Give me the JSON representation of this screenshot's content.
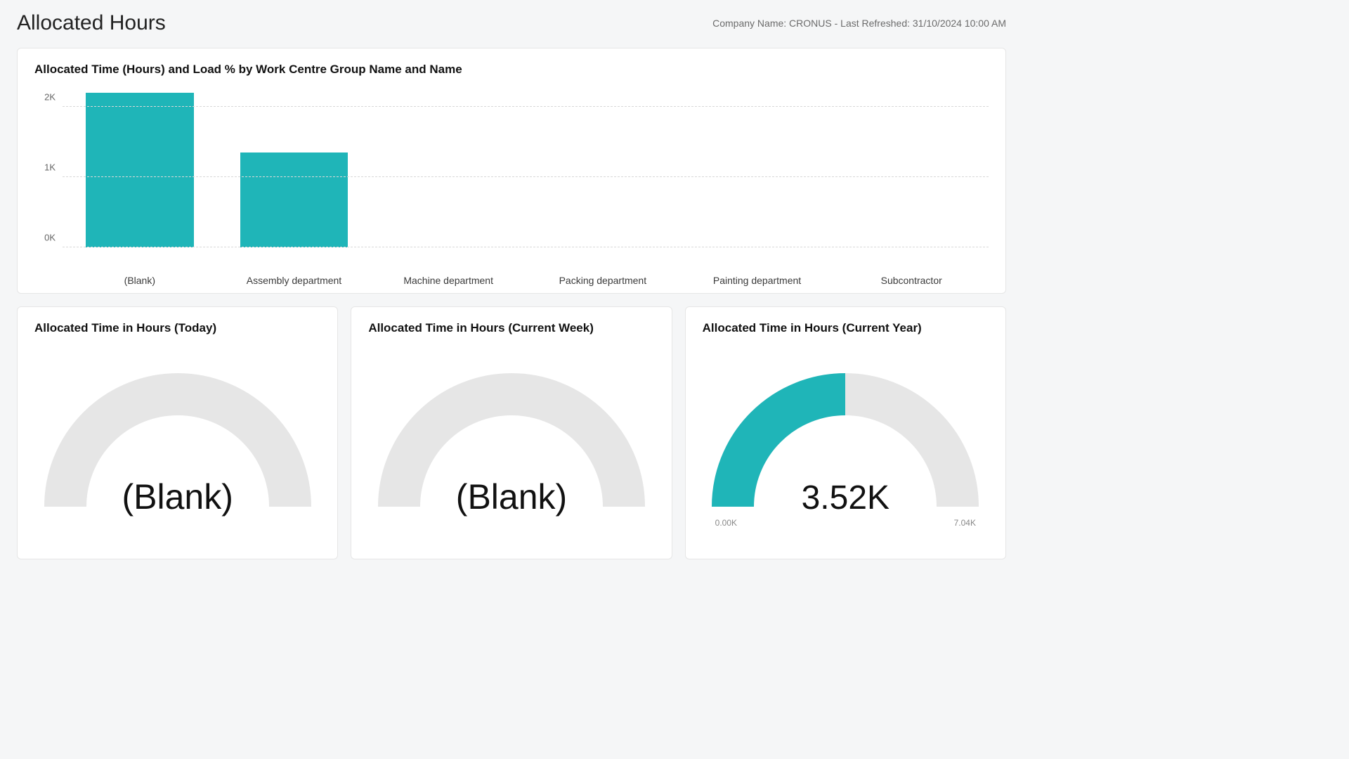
{
  "header": {
    "title": "Allocated Hours",
    "info": "Company Name: CRONUS - Last Refreshed: 31/10/2024 10:00 AM"
  },
  "bar_card": {
    "title": "Allocated Time (Hours) and Load % by Work Centre Group Name and Name"
  },
  "chart_data": {
    "type": "bar",
    "categories": [
      "(Blank)",
      "Assembly department",
      "Machine department",
      "Packing department",
      "Painting department",
      "Subcontractor"
    ],
    "values": [
      2200,
      1350,
      0,
      0,
      0,
      0
    ],
    "y_ticks": [
      0,
      1000,
      2000
    ],
    "y_tick_labels": [
      "0K",
      "1K",
      "2K"
    ],
    "ylim": [
      0,
      2300
    ],
    "title": "Allocated Time (Hours) and Load % by Work Centre Group Name and Name",
    "xlabel": "",
    "ylabel": ""
  },
  "gauges": [
    {
      "title": "Allocated Time in Hours (Today)",
      "value_label": "(Blank)",
      "value": null,
      "min_label": "",
      "max_label": "",
      "fill_fraction": 0
    },
    {
      "title": "Allocated Time in Hours (Current Week)",
      "value_label": "(Blank)",
      "value": null,
      "min_label": "",
      "max_label": "",
      "fill_fraction": 0
    },
    {
      "title": "Allocated Time in Hours (Current Year)",
      "value_label": "3.52K",
      "value": 3520,
      "min": 0,
      "max": 7040,
      "min_label": "0.00K",
      "max_label": "7.04K",
      "fill_fraction": 0.5
    }
  ]
}
